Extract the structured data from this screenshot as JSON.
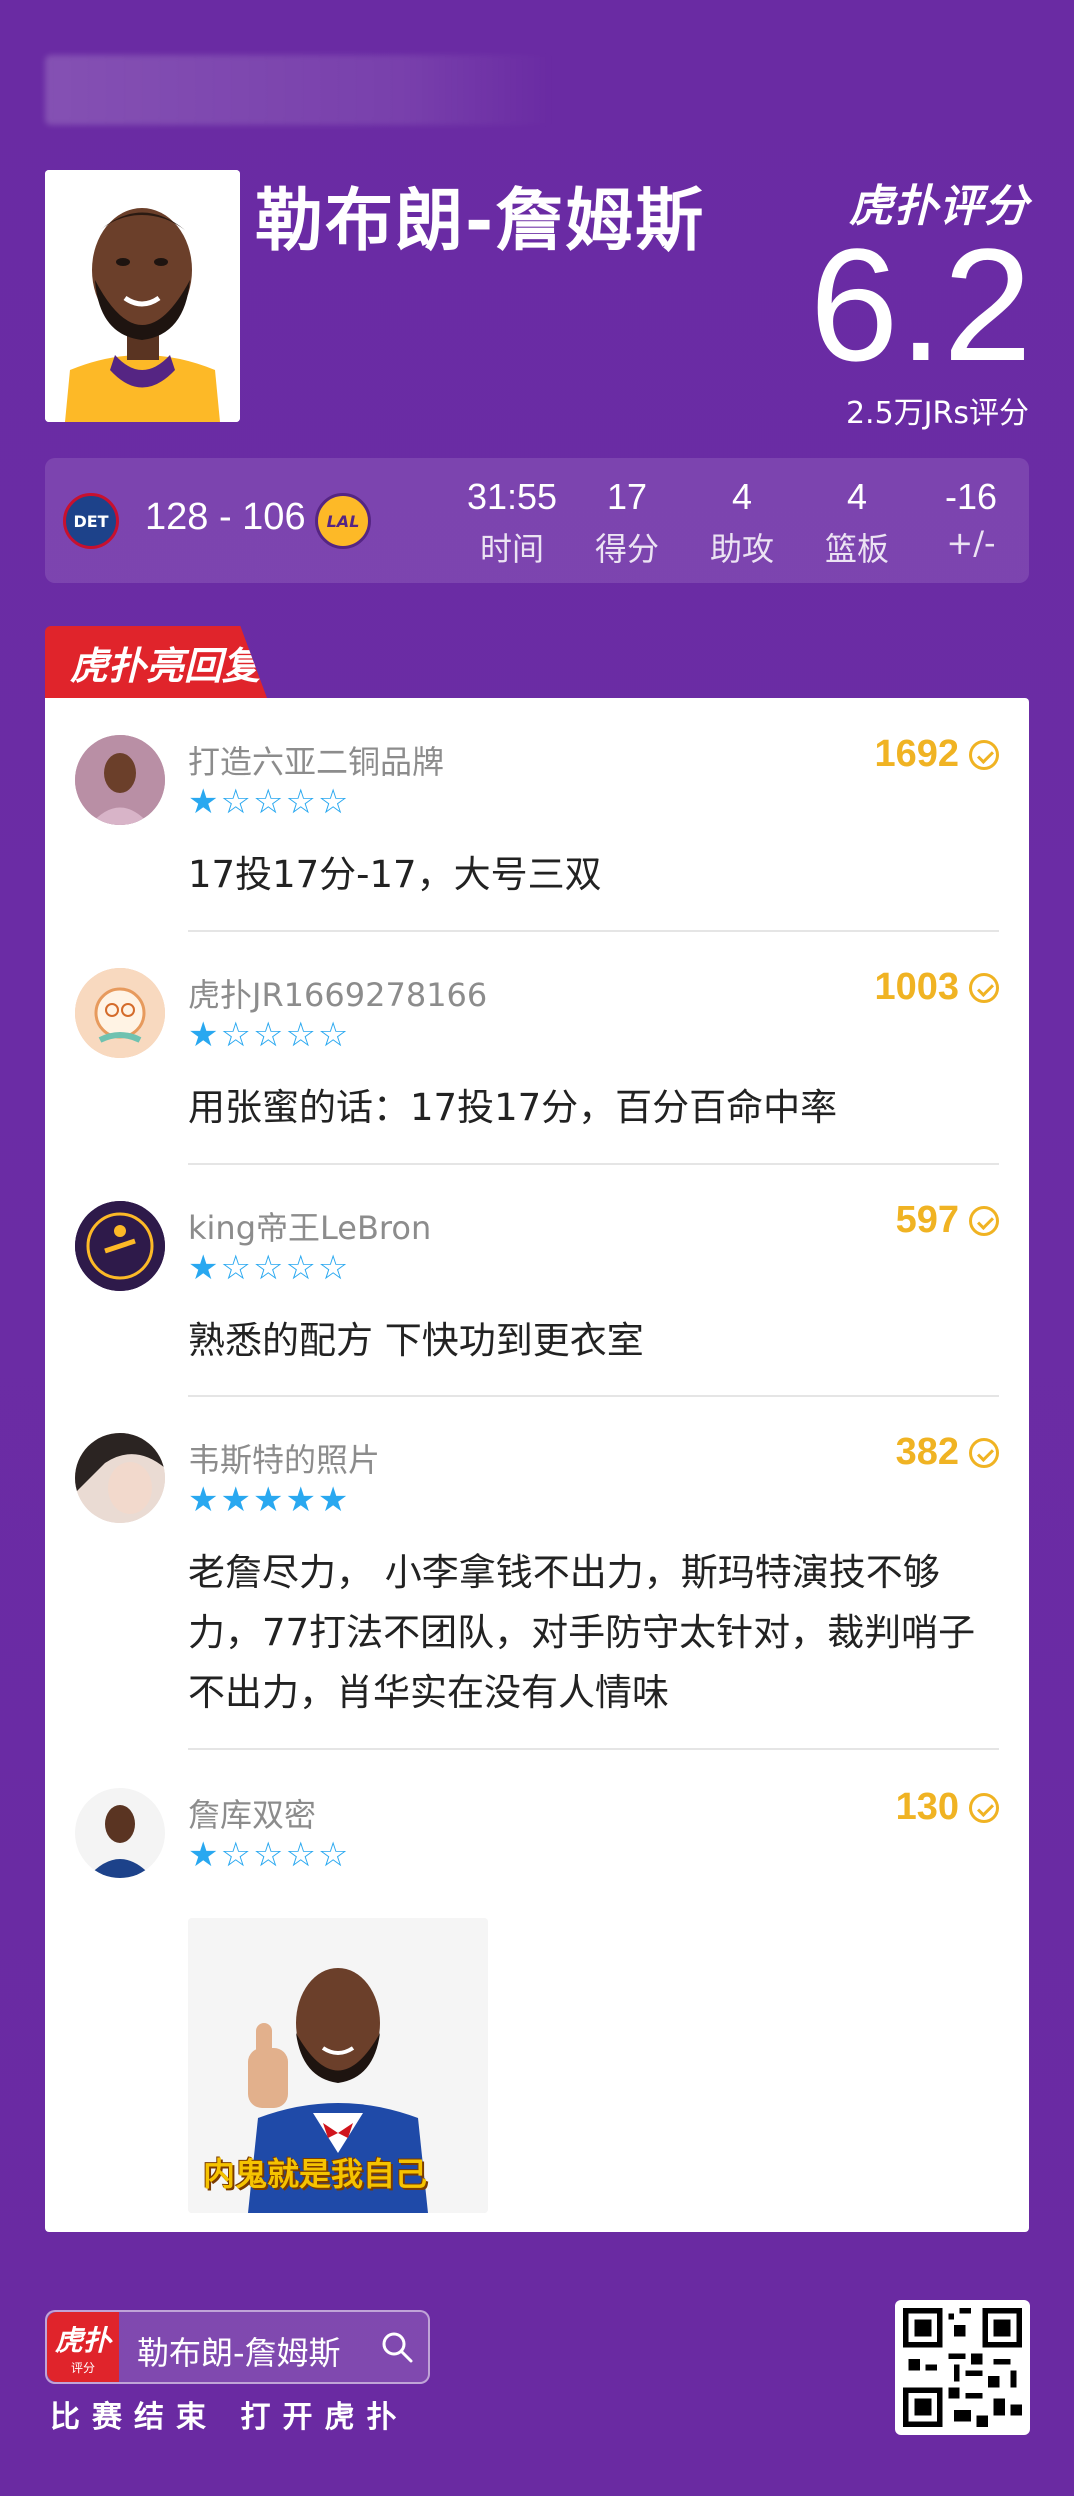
{
  "player": {
    "name": "勒布朗-詹姆斯"
  },
  "rating": {
    "logo": "虎扑评分",
    "value": "6.2",
    "count": "2.5万JRs评分"
  },
  "game": {
    "home_team": "DET",
    "away_team": "LAL",
    "score": "128 - 106",
    "stats": [
      {
        "value": "31:55",
        "label": "时间"
      },
      {
        "value": "17",
        "label": "得分"
      },
      {
        "value": "4",
        "label": "助攻"
      },
      {
        "value": "4",
        "label": "篮板"
      },
      {
        "value": "-16",
        "label": "+/-"
      }
    ]
  },
  "section_tag": "虎扑亮回复",
  "comments": [
    {
      "user": "打造六亚二铜品牌",
      "likes": "1692",
      "stars": 1,
      "text": "17投17分-17，大号三双"
    },
    {
      "user": "虎扑JR1669278166",
      "likes": "1003",
      "stars": 1,
      "text": "用张蜜的话：17投17分，百分百命中率"
    },
    {
      "user": "king帝王LeBron",
      "likes": "597",
      "stars": 1,
      "text": "熟悉的配方 下快功到更衣室"
    },
    {
      "user": "韦斯特的照片",
      "likes": "382",
      "stars": 5,
      "text": "老詹尽力， 小李拿钱不出力，斯玛特演技不够力，77打法不团队，对手防守太针对，裁判哨子不出力，肖华实在没有人情味"
    },
    {
      "user": "詹库双密",
      "likes": "130",
      "stars": 1,
      "text": "",
      "image_caption": "内鬼就是我自己"
    }
  ],
  "footer": {
    "app_icon": "虎扑",
    "app_icon_sub": "评分",
    "title": "勒布朗-詹姆斯",
    "slogan": "比赛结束 打开虎扑"
  },
  "colors": {
    "background": "#6a2ba3",
    "accent_red": "#e0242b",
    "likes": "#f0b323",
    "stars": "#29a8f0"
  }
}
